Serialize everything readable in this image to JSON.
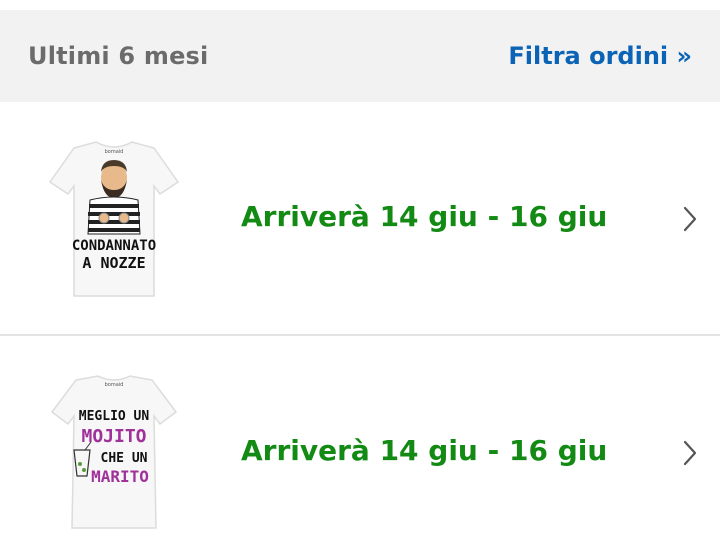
{
  "header": {
    "title": "Ultimi 6 mesi",
    "filter_link": "Filtra ordini »"
  },
  "orders": [
    {
      "delivery": "Arriverà 14 giu - 16 giu",
      "product_print": [
        "CONDANNATO",
        "A NOZZE"
      ],
      "tag_text": "bomaid"
    },
    {
      "delivery": "Arriverà 14 giu - 16 giu",
      "product_print": [
        "MEGLIO UN",
        "MOJITO",
        "CHE UN",
        "MARITO"
      ],
      "tag_text": "bomaid"
    }
  ],
  "colors": {
    "header_bg": "#f2f2f2",
    "link": "#0b63b5",
    "delivery": "#138a13",
    "accent_purple": "#a0309a"
  },
  "icons": [
    "chevron-right-icon"
  ]
}
